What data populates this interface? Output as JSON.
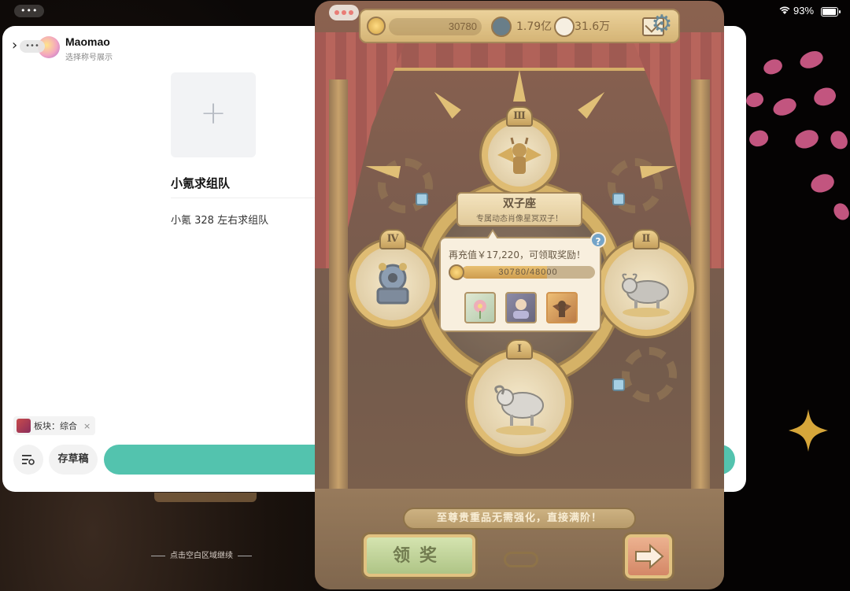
{
  "status_bar": {
    "battery_text": "93%",
    "multitask_dots": "•••"
  },
  "hint_text": "点击空白区域继续",
  "left_app": {
    "back_symbol": "›",
    "more_dots": "•••",
    "user_name": "Maomao",
    "user_subtitle": "选择称号展示",
    "add_symbol": "+",
    "post_title": "小氪求组队",
    "post_body": "小氪 328 左右求组队",
    "tag_label": "板块：综合",
    "tag_close": "×",
    "save_draft_label": "存草稿"
  },
  "game": {
    "currency": {
      "coins": "30780",
      "value_2": "1.79亿",
      "value_3": "31.6万"
    },
    "banner": {
      "title": "双子座",
      "subtitle": "专属动态肖像星冥双子！"
    },
    "popup": {
      "message": "再充值￥17,220，可领取奖励！",
      "progress_text": "30780/48000",
      "progress_fraction": 0.64125,
      "help_symbol": "?"
    },
    "medals": {
      "top": "Ⅲ",
      "left": "Ⅳ",
      "right": "Ⅱ",
      "bottom": "Ⅰ"
    },
    "bottom_banner": "至尊贵重品无需强化，直接满阶！",
    "claim_label": "领奖"
  },
  "colors": {
    "publish_teal": "#53c3ae",
    "gold": "#c9a048",
    "help_blue": "#4e8fc4"
  },
  "icons": [
    "wifi-icon",
    "battery-icon",
    "back-icon",
    "avatar",
    "plus-icon",
    "filter-icon",
    "coin-icon",
    "gem-icon",
    "chat-icon",
    "mail-icon",
    "gear-icon",
    "arrow-right-icon"
  ]
}
